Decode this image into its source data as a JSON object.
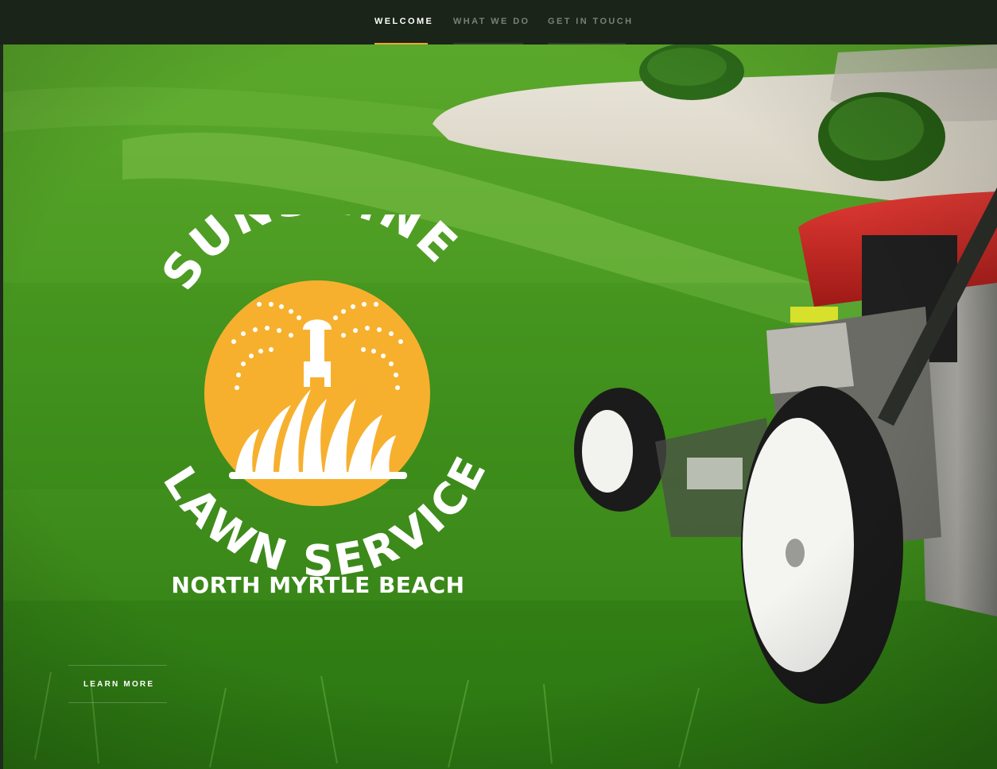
{
  "nav": {
    "items": [
      {
        "label": "WELCOME",
        "active": true
      },
      {
        "label": "WHAT WE DO",
        "active": false
      },
      {
        "label": "GET IN TOUCH",
        "active": false
      }
    ]
  },
  "hero": {
    "logo": {
      "arc_top": "SUNSHINE",
      "arc_bottom": "LAWN SERVICE",
      "location": "NORTH MYRTLE BEACH"
    },
    "cta_label": "LEARN MORE",
    "background_description_icon": "lawn-mower-on-grass"
  },
  "colors": {
    "nav_bg": "#1a2418",
    "active_underline": "#f0a43a",
    "logo_sun": "#f7b02e",
    "grass": "#3f8f1d"
  }
}
